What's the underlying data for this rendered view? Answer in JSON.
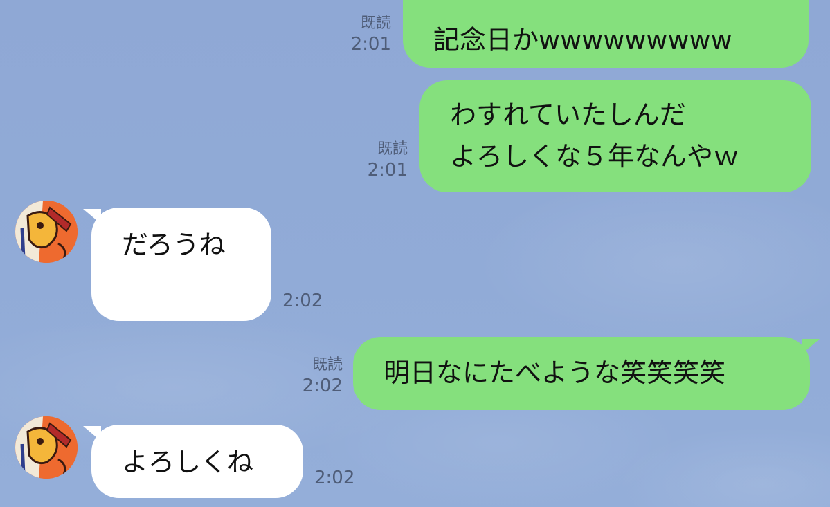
{
  "app": "LINE",
  "colors": {
    "background": "#8fa8d5",
    "sent_bubble": "#85e07d",
    "received_bubble": "#ffffff",
    "meta_text": "#4f5d78"
  },
  "messages": [
    {
      "direction": "sent",
      "read": "既読",
      "time": "2:01",
      "lines": [
        "記念日かwwwwwwwww"
      ]
    },
    {
      "direction": "sent",
      "read": "既読",
      "time": "2:01",
      "lines": [
        "わすれていたしんだ",
        "よろしくな５年なんやｗ"
      ]
    },
    {
      "direction": "received",
      "time": "2:02",
      "lines": [
        "だろうね"
      ]
    },
    {
      "direction": "sent",
      "read": "既読",
      "time": "2:02",
      "lines": [
        "明日なにたべような笑笑笑笑"
      ]
    },
    {
      "direction": "received",
      "time": "2:02",
      "lines": [
        "よろしくね"
      ]
    }
  ]
}
